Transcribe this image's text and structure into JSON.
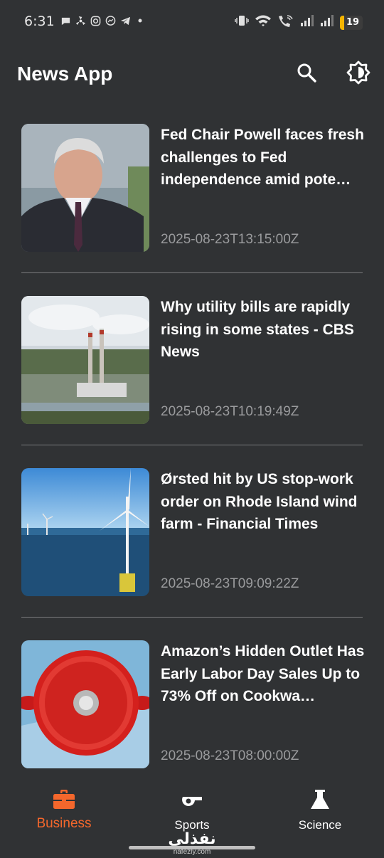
{
  "status_bar": {
    "time": "6:31",
    "battery": "19",
    "battery_color": "#f5b400",
    "left_icons": [
      "chat-icon",
      "fan-icon",
      "instagram-icon",
      "messenger-icon",
      "telegram-icon",
      "dot-icon"
    ],
    "right_icons": [
      "vibrate-icon",
      "wifi-icon",
      "wifi-call-icon",
      "signal-icon",
      "signal-icon"
    ]
  },
  "app_bar": {
    "title": "News App",
    "icons": [
      "search-icon",
      "brightness-icon"
    ]
  },
  "articles": [
    {
      "title": "Fed Chair Powell faces fresh challenges to Fed independence amid pote…",
      "date": "2025-08-23T13:15:00Z",
      "image": "man-in-suit-portrait"
    },
    {
      "title": "Why utility bills are rapidly rising in some states - CBS News",
      "date": "2025-08-23T10:19:49Z",
      "image": "power-plant-smokestacks"
    },
    {
      "title": "Ørsted hit by US stop-work order on Rhode Island wind farm - Financial Times",
      "date": "2025-08-23T09:09:22Z",
      "image": "offshore-wind-turbines"
    },
    {
      "title": "Amazon’s Hidden Outlet Has Early Labor Day Sales Up to 73% Off on Cookwa…",
      "date": "2025-08-23T08:00:00Z",
      "image": "red-dutch-oven-pot"
    }
  ],
  "bottom_nav": {
    "items": [
      {
        "label": "Business",
        "icon": "briefcase-icon",
        "active": true
      },
      {
        "label": "Sports",
        "icon": "whistle-icon",
        "active": false
      },
      {
        "label": "Science",
        "icon": "flask-icon",
        "active": false
      }
    ],
    "active_color": "#f4672c"
  },
  "watermark": {
    "text": "نفذلي",
    "sub": "nafezly.com"
  },
  "colors": {
    "background": "#303234",
    "divider": "#7b7b7d",
    "date_text": "#9a9b9d"
  }
}
